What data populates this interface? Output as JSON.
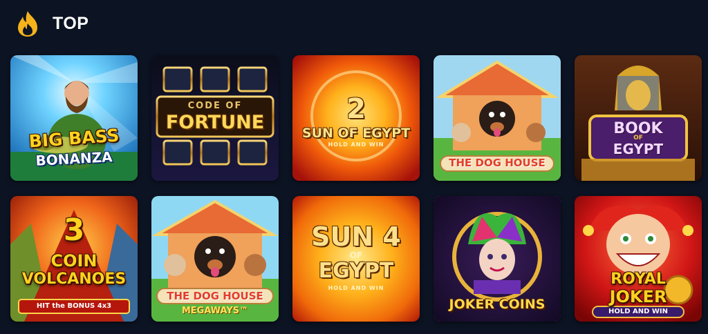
{
  "section": {
    "title": "TOP",
    "icon": "fire-icon",
    "accent": "#f5b21b"
  },
  "games": [
    {
      "lines": [
        "BIG BASS",
        "BONANZA"
      ]
    },
    {
      "lines": [
        "CODE OF",
        "FORTUNE"
      ]
    },
    {
      "lines": [
        "2",
        "SUN OF EGYPT",
        "HOLD AND WIN"
      ]
    },
    {
      "lines": [
        "THE DOG HOUSE"
      ]
    },
    {
      "lines": [
        "BOOK",
        "OF",
        "EGYPT"
      ]
    },
    {
      "lines": [
        "3",
        "COIN",
        "VOLCANOES",
        "HIT the BONUS 4x3"
      ]
    },
    {
      "lines": [
        "THE DOG HOUSE",
        "MEGAWAYS™"
      ]
    },
    {
      "lines": [
        "SUN 4",
        "OF",
        "EGYPT",
        "HOLD AND WIN"
      ]
    },
    {
      "lines": [
        "JOKER COINS"
      ],
      "selected": true
    },
    {
      "lines": [
        "ROYAL",
        "JOKER",
        "HOLD AND WIN"
      ]
    }
  ]
}
